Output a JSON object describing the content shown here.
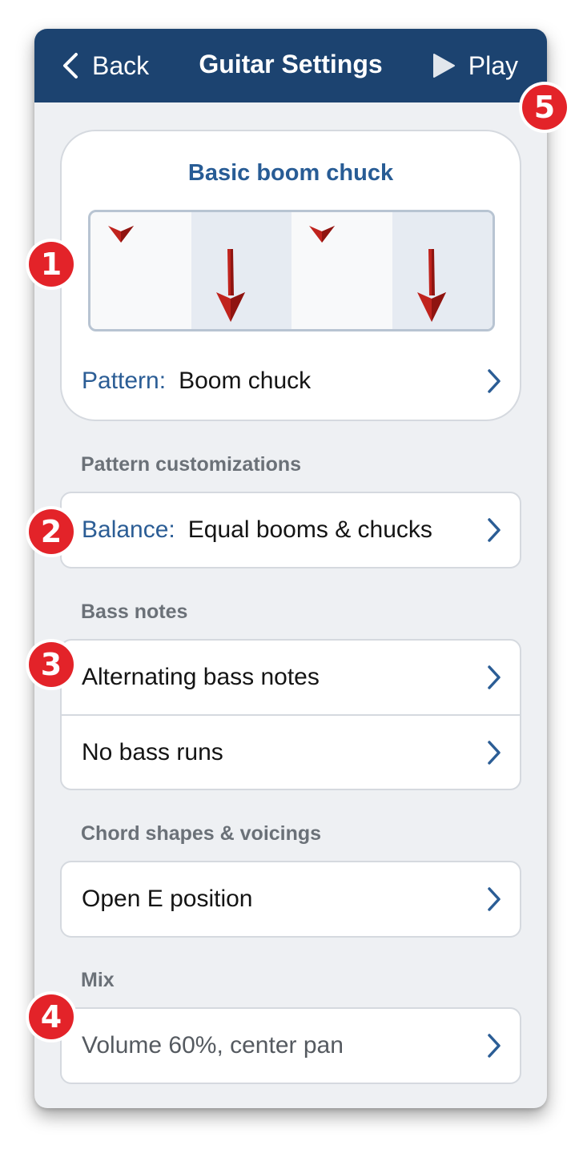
{
  "navbar": {
    "back_label": "Back",
    "title": "Guitar Settings",
    "play_label": "Play"
  },
  "pattern_card": {
    "title": "Basic boom chuck",
    "beats": [
      {
        "type": "small-down",
        "shaded": false
      },
      {
        "type": "big-down",
        "shaded": true
      },
      {
        "type": "small-down",
        "shaded": false
      },
      {
        "type": "big-down",
        "shaded": true
      }
    ],
    "pattern_key": "Pattern:",
    "pattern_value": "Boom chuck"
  },
  "sections": {
    "customizations_label": "Pattern customizations",
    "balance_key": "Balance:",
    "balance_value": "Equal booms & chucks",
    "bass_label": "Bass notes",
    "bass_item_1": "Alternating bass notes",
    "bass_item_2": "No bass runs",
    "chords_label": "Chord shapes & voicings",
    "chords_item": "Open E position",
    "mix_label": "Mix",
    "mix_item": "Volume 60%, center pan"
  },
  "badges": [
    "1",
    "2",
    "3",
    "4",
    "5"
  ],
  "colors": {
    "navbar_bg": "#1c4370",
    "accent_blue": "#285c95",
    "arrow_red": "#c0231d",
    "badge_red": "#e32329",
    "background": "#eef0f3"
  }
}
